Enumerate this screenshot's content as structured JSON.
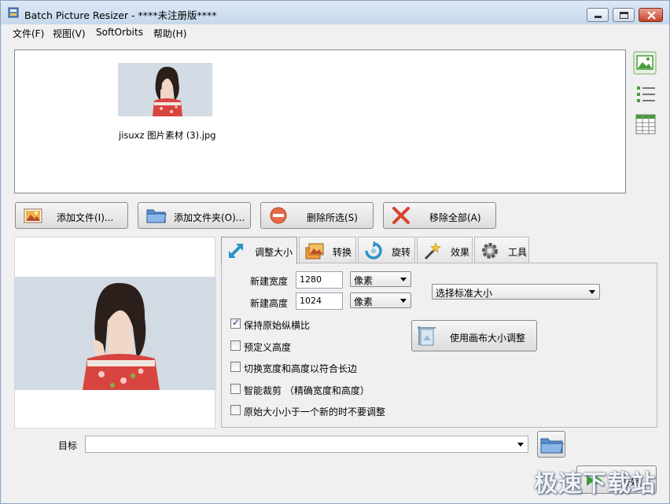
{
  "window": {
    "title": "Batch Picture Resizer - ****未注册版****"
  },
  "menu": [
    "文件(F)",
    "视图(V)",
    "SoftOrbits",
    "帮助(H)"
  ],
  "file_list": {
    "items": [
      {
        "filename": "jisuxz 图片素材 (3).jpg"
      }
    ]
  },
  "view_modes": [
    "thumbnail-view-icon",
    "list-view-icon",
    "grid-view-icon"
  ],
  "toolbar": {
    "add_files": "添加文件(I)...",
    "add_folder": "添加文件夹(O)...",
    "delete_selected": "删除所选(S)",
    "remove_all": "移除全部(A)"
  },
  "tabs": [
    {
      "label": "调整大小",
      "icon": "resize-arrow-icon",
      "active": true
    },
    {
      "label": "转换",
      "icon": "convert-image-icon",
      "active": false
    },
    {
      "label": "旋转",
      "icon": "rotate-icon",
      "active": false
    },
    {
      "label": "效果",
      "icon": "magic-wand-icon",
      "active": false
    },
    {
      "label": "工具",
      "icon": "gear-icon",
      "active": false
    }
  ],
  "resize": {
    "width_label": "新建宽度",
    "width_value": "1280",
    "width_unit": "像素",
    "height_label": "新建高度",
    "height_value": "1024",
    "height_unit": "像素",
    "standard_size": "选择标准大小",
    "canvas_button": "使用画布大小调整",
    "options": [
      {
        "label": "保持原始纵横比",
        "checked": true
      },
      {
        "label": "预定义高度",
        "checked": false
      },
      {
        "label": "切换宽度和高度以符合长边",
        "checked": false
      },
      {
        "label": "智能裁剪 （精确宽度和高度）",
        "checked": false
      },
      {
        "label": "原始大小小于一个新的时不要调整",
        "checked": false
      }
    ]
  },
  "target": {
    "label": "目标",
    "value": ""
  },
  "start_button": "开始",
  "watermark": "极速下载站",
  "colors": {
    "title_bar": "#c7d8ec",
    "client_bg": "#f0f0f0",
    "close_button": "#c8412a",
    "accent_green": "#4a9a3c"
  }
}
